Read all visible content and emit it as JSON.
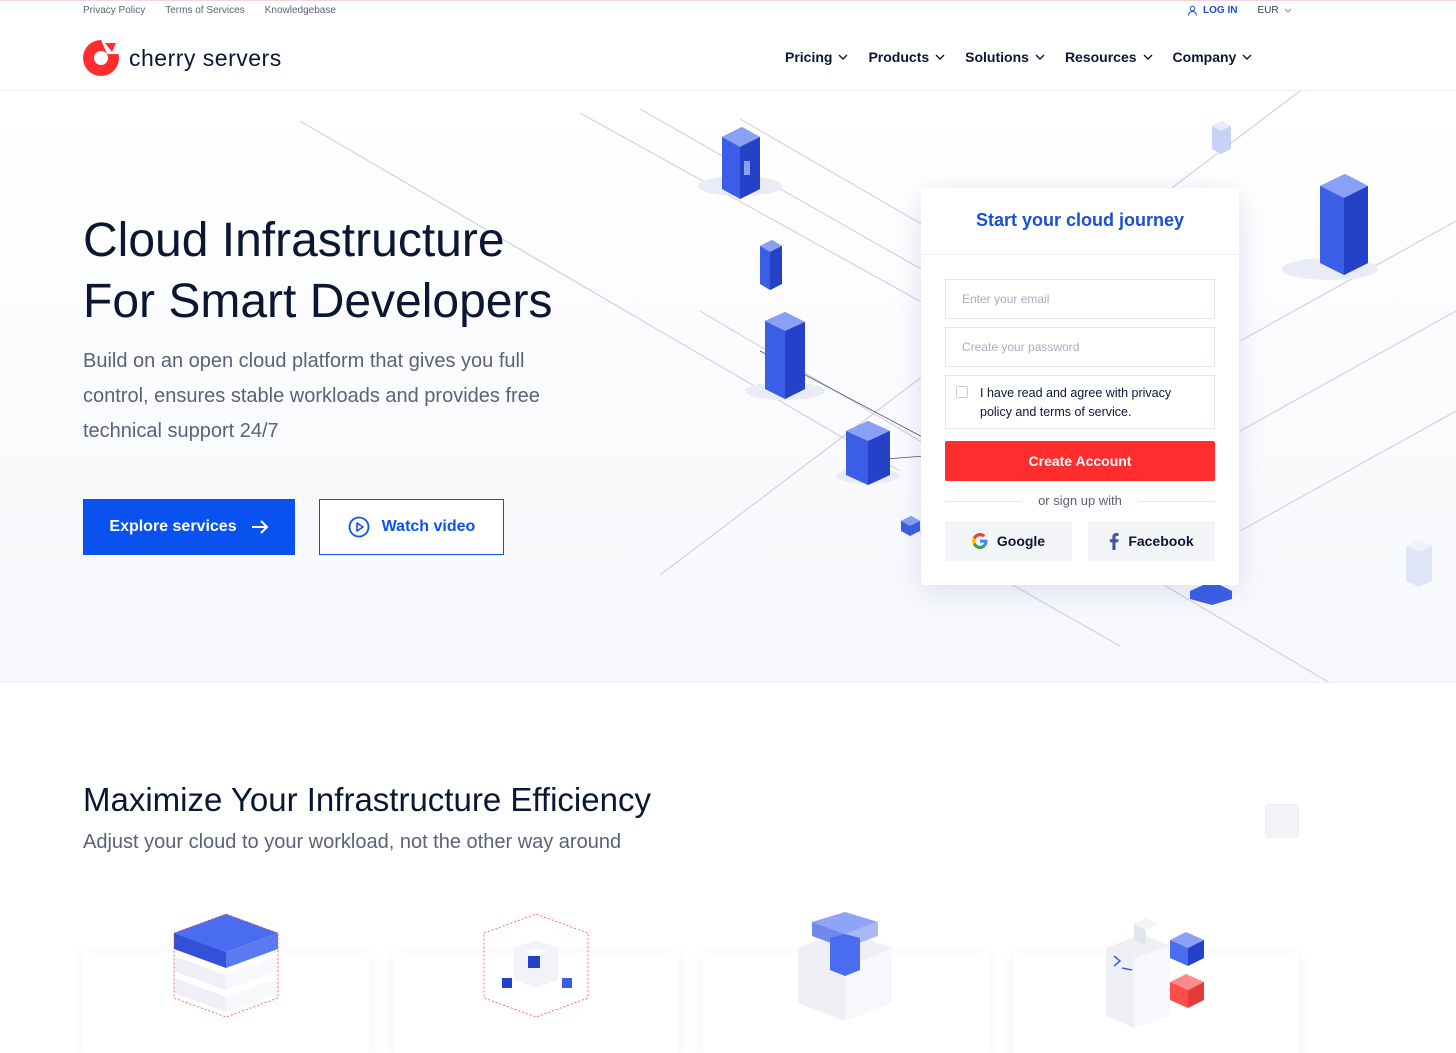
{
  "topbar": {
    "links": [
      "Privacy Policy",
      "Terms of Services",
      "Knowledgebase"
    ],
    "login_label": "LOG IN",
    "currency": "EUR"
  },
  "header": {
    "brand": "cherry servers",
    "nav": [
      "Pricing",
      "Products",
      "Solutions",
      "Resources",
      "Company"
    ]
  },
  "hero": {
    "title_line1": "Cloud Infrastructure",
    "title_line2": "For Smart Developers",
    "subtitle": "Build on an open cloud platform that gives you full control, ensures stable workloads and provides free technical support 24/7",
    "explore_label": "Explore services",
    "watch_label": "Watch video"
  },
  "signup": {
    "title": "Start your cloud journey",
    "email_placeholder": "Enter your email",
    "password_placeholder": "Create your password",
    "agree_text": "I have read and agree with privacy policy and terms of service.",
    "create_label": "Create Account",
    "or_text": "or sign up with",
    "google_label": "Google",
    "facebook_label": "Facebook"
  },
  "section2": {
    "title": "Maximize Your Infrastructure Efficiency",
    "subtitle": "Adjust your cloud to your workload, not the other way around"
  },
  "colors": {
    "brand_red": "#ff2d2d",
    "primary_blue": "#0a52f0",
    "accent_blue": "#1a4fd6",
    "text_dark": "#0b1633",
    "text_muted": "#5b6275"
  }
}
